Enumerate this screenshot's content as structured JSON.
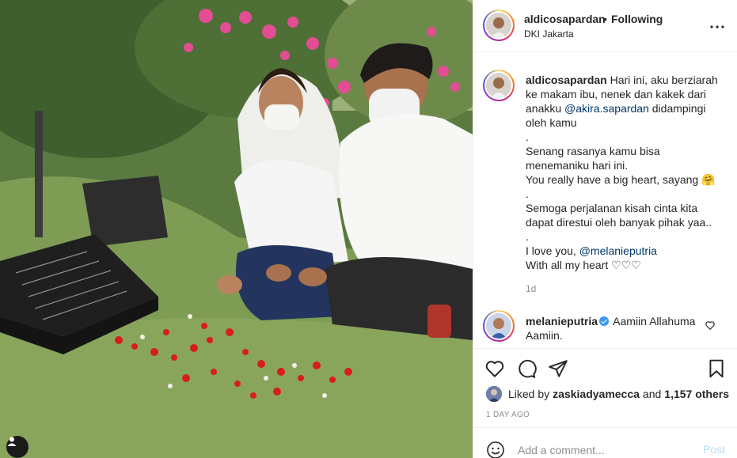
{
  "header": {
    "username": "aldicosapardan",
    "separator": "•",
    "follow_status": "Following",
    "location": "DKI Jakarta"
  },
  "caption": {
    "username": "aldicosapardan",
    "line1": "Hari ini, aku berziarah ke makam ibu, nenek dan kakek dari anakku ",
    "mention1": "@akira.sapardan",
    "line1_end": " didampingi oleh kamu",
    "dot1": ".",
    "line2": "Senang rasanya kamu bisa menemaniku hari ini.",
    "line3": "You really have a big heart, sayang 🤗",
    "dot2": ".",
    "line4": "Semoga perjalanan kisah cinta kita dapat direstui oleh banyak pihak yaa..",
    "dot3": ".",
    "line5_prefix": "I love you, ",
    "mention2": "@melanieputria",
    "line6": "With all my heart ♡♡♡",
    "time": "1d"
  },
  "comment": {
    "username": "melanieputria",
    "text": "Aamiin Allahuma Aamiin."
  },
  "likes": {
    "prefix": "Liked by",
    "user": "zaskiadyamecca",
    "and": "and",
    "count": "1,157 others"
  },
  "post_date": "1 DAY AGO",
  "add_comment": {
    "placeholder": "Add a comment...",
    "post_label": "Post"
  },
  "icons": {
    "more": "more-horizontal-icon",
    "like": "heart-icon",
    "comment": "comment-bubble-icon",
    "share": "paper-plane-icon",
    "save": "bookmark-icon",
    "emoji": "smiley-icon",
    "tag": "user-tag-icon"
  },
  "colors": {
    "link": "#00376b",
    "muted": "#8e8e8e",
    "post_disabled": "#b2dffc",
    "verified": "#3897f0"
  }
}
